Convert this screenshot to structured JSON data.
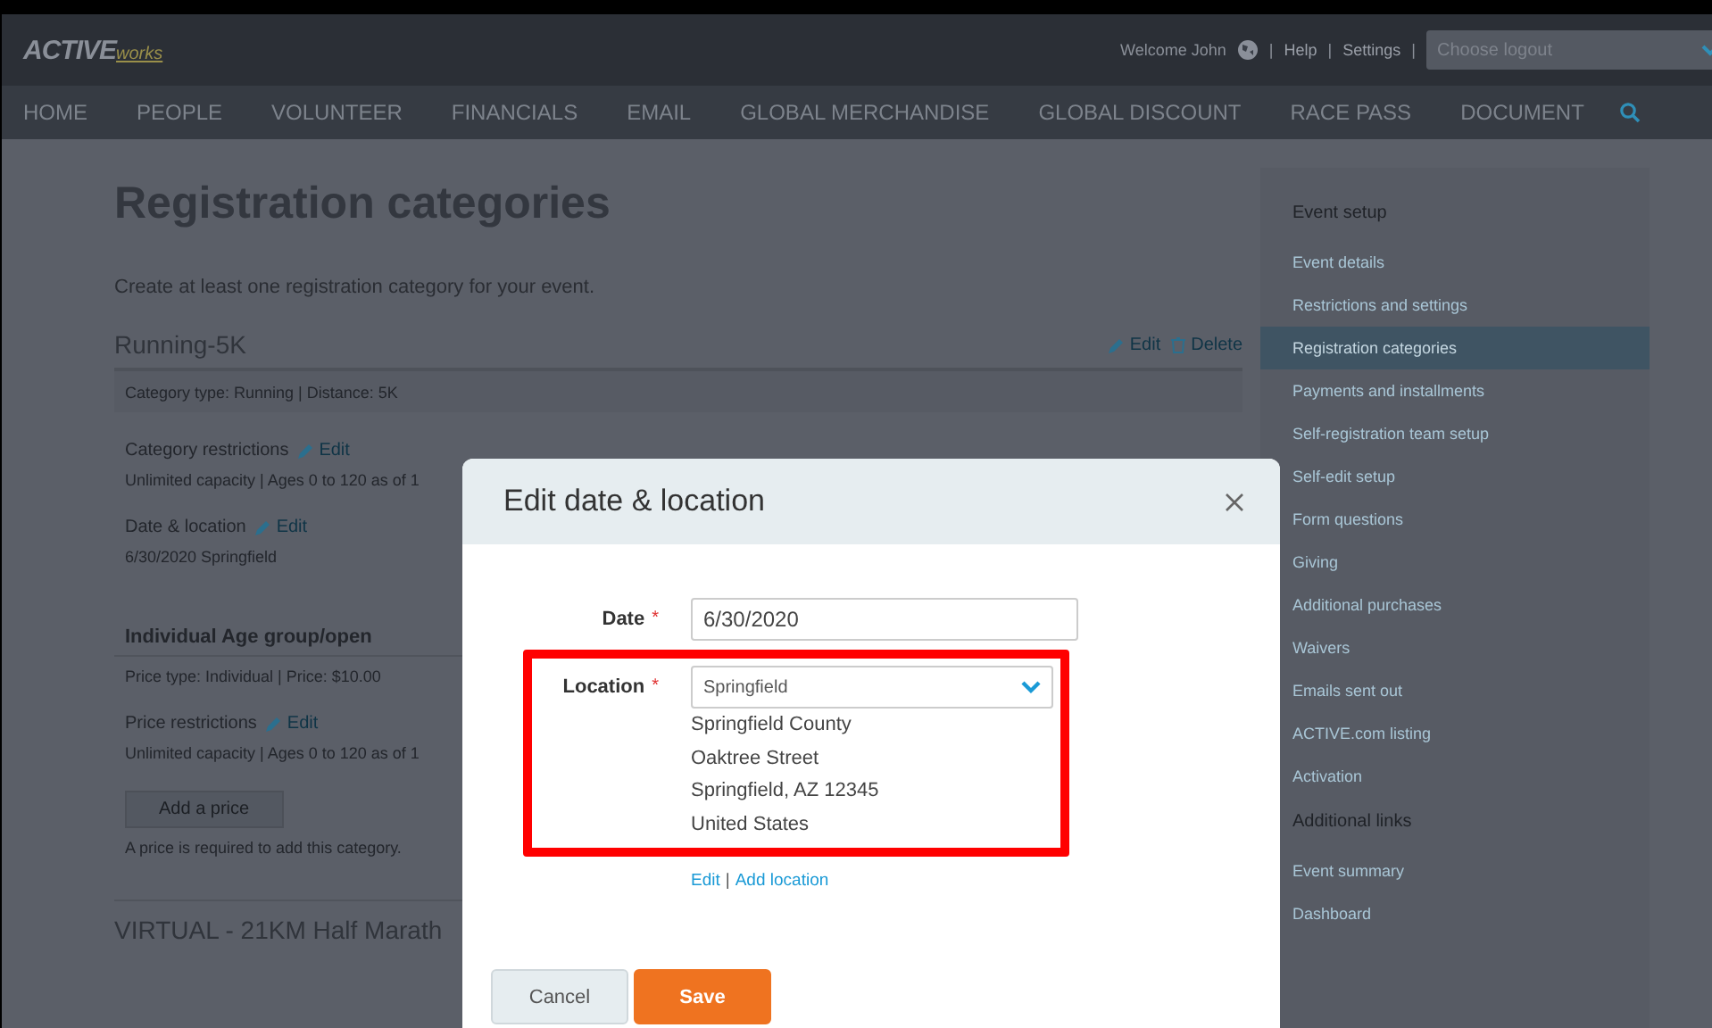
{
  "header": {
    "logo": "ACTIVE",
    "logo_suffix": "works",
    "welcome": "Welcome John",
    "links": [
      "Help",
      "Settings"
    ],
    "separator": "|",
    "logout_select": {
      "placeholder": "Choose logout"
    }
  },
  "nav": [
    {
      "label": "HOME"
    },
    {
      "label": "PEOPLE"
    },
    {
      "label": "VOLUNTEER"
    },
    {
      "label": "FINANCIALS"
    },
    {
      "label": "EMAIL"
    },
    {
      "label": "GLOBAL MERCHANDISE"
    },
    {
      "label": "GLOBAL DISCOUNT"
    },
    {
      "label": "RACE PASS"
    },
    {
      "label": "DOCUMENT"
    }
  ],
  "page": {
    "title": "Registration categories",
    "subtitle": "Create at least one registration category for your event.",
    "category": {
      "name": "Running-5K",
      "actions": [
        "Edit",
        "Delete"
      ],
      "info": "Category type: Running | Distance: 5K",
      "sections": [
        {
          "label": "Category restrictions",
          "edit": "Edit",
          "detail": "Unlimited capacity | Ages 0 to 120 as of 1"
        },
        {
          "label": "Date & location",
          "edit": "Edit",
          "detail": "6/30/2020 Springfield"
        }
      ],
      "price": {
        "name": "Individual Age group/open",
        "info": "Price type: Individual | Price: $10.00",
        "restrictions_label": "Price restrictions",
        "restrictions_edit": "Edit",
        "restrictions_detail": "Unlimited capacity | Ages 0 to 120 as of 1",
        "add_button": "Add a price",
        "note": "A price is required to add this category."
      }
    },
    "next_category": "VIRTUAL - 21KM Half Marath"
  },
  "sidebar": {
    "sections": [
      {
        "heading": "Event setup",
        "items": [
          {
            "label": "Event details",
            "selected": false
          },
          {
            "label": "Restrictions and settings",
            "selected": false
          },
          {
            "label": "Registration categories",
            "selected": true
          },
          {
            "label": "Payments and installments",
            "selected": false
          },
          {
            "label": "Self-registration team setup",
            "selected": false
          },
          {
            "label": "Self-edit setup",
            "selected": false
          },
          {
            "label": "Form questions",
            "selected": false
          },
          {
            "label": "Giving",
            "selected": false
          },
          {
            "label": "Additional purchases",
            "selected": false
          },
          {
            "label": "Waivers",
            "selected": false
          },
          {
            "label": "Emails sent out",
            "selected": false
          },
          {
            "label": "ACTIVE.com listing",
            "selected": false
          },
          {
            "label": "Activation",
            "selected": false
          }
        ]
      },
      {
        "heading": "Additional links",
        "items": [
          {
            "label": "Event summary",
            "selected": false
          },
          {
            "label": "Dashboard",
            "selected": false
          }
        ]
      }
    ]
  },
  "modal": {
    "title": "Edit date & location",
    "date": {
      "label": "Date",
      "required_mark": "*",
      "value": "6/30/2020"
    },
    "location": {
      "label": "Location",
      "required_mark": "*",
      "value": "Springfield",
      "address": [
        "Springfield County",
        "Oaktree Street",
        "Springfield, AZ 12345",
        "United States"
      ],
      "highlighted": true
    },
    "links": [
      "Edit",
      "Add location"
    ],
    "link_separator": "|",
    "buttons": [
      {
        "label": "Cancel",
        "kind": "secondary"
      },
      {
        "label": "Save",
        "kind": "primary"
      }
    ]
  }
}
